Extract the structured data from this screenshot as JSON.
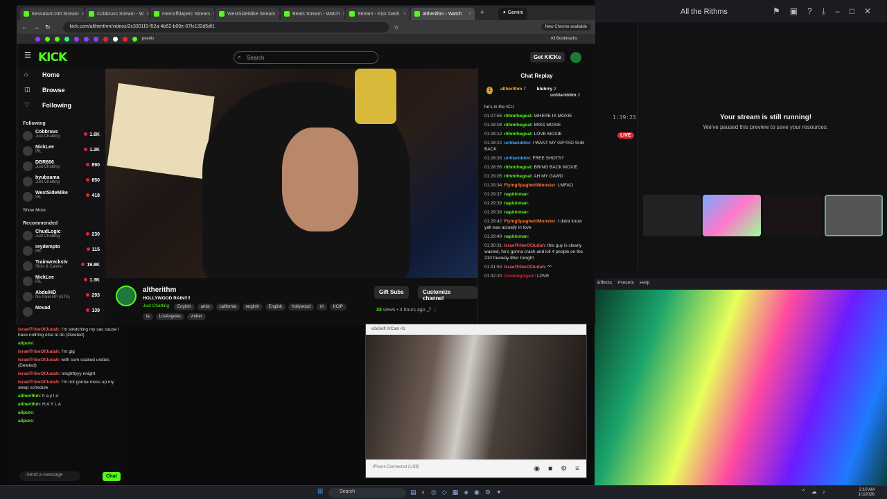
{
  "browser": {
    "tabs": [
      "Kevsaturn100 Stream",
      "Cobbruvs Stream - W",
      "mercoffdaperc Stream",
      "WestSideMike Stream",
      "Beats Stream - Watch",
      "Stream - Kick Dash",
      "altherithm - Watch"
    ],
    "gemini": "Gemini",
    "url": "kick.com/altherithm/videos/2c3301f3-f52a-4b52-b00e-07fc132d5df1",
    "new_chrome": "New Chrome available",
    "all_bookmarks": "All Bookmarks",
    "pexels": "pexels"
  },
  "kick": {
    "logo": "KICK",
    "search_placeholder": "Search",
    "get_kicks": "Get KICKs",
    "nav": [
      {
        "label": "Home",
        "icon": "home-icon"
      },
      {
        "label": "Browse",
        "icon": "browse-icon"
      },
      {
        "label": "Following",
        "icon": "heart-icon"
      }
    ],
    "following_header": "Following",
    "following": [
      {
        "name": "Cobbruvs",
        "category": "Just Chatting",
        "viewers": "1.6K"
      },
      {
        "name": "NickLee",
        "category": "IRL",
        "viewers": "1.2K"
      },
      {
        "name": "DBR666",
        "category": "Just Chatting",
        "viewers": "890"
      },
      {
        "name": "hyubsama",
        "category": "Just Chatting",
        "viewers": "850"
      },
      {
        "name": "WestSideMike",
        "category": "IRL",
        "viewers": "418"
      }
    ],
    "show_more": "Show More",
    "recommended_header": "Recommended",
    "recommended": [
      {
        "name": "ChudLogic",
        "category": "Just Chatting",
        "viewers": "230"
      },
      {
        "name": "reydempto",
        "category": "IRL",
        "viewers": "115"
      },
      {
        "name": "Trainwreckstv",
        "category": "Slots & Casino",
        "viewers": "19.8K"
      },
      {
        "name": "NickLee",
        "category": "IRL",
        "viewers": "1.3K"
      },
      {
        "name": "AbdulHD",
        "category": "No Pixel RP (GTA)",
        "viewers": "293"
      },
      {
        "name": "Novad",
        "category": "",
        "viewers": "139"
      }
    ],
    "channel": {
      "name": "altherithm",
      "title": "HOLLYWOOD RAIN!!!!",
      "category": "Just Chatting",
      "tags": [
        "English",
        "artist",
        "california",
        "english",
        "English",
        "hollywood",
        "irl",
        "KCIP",
        "la",
        "LosAngeles",
        "vtuber"
      ],
      "gift_subs": "Gift Subs",
      "customize": "Customize channel",
      "views": "33",
      "views_label": "views",
      "ago": "4 hours ago"
    },
    "chat": {
      "header": "Chat Replay",
      "top": [
        {
          "rank": "1",
          "name": "altherithm",
          "count": "7"
        },
        {
          "name": "bluhrry",
          "count": "2"
        },
        {
          "name": "unfdariddim",
          "count": "2"
        }
      ],
      "first_line": "he's in the ICU",
      "messages": [
        {
          "time": "01:27:56",
          "user": "rithmthegoat",
          "text": ": WHERE IS MOXIE",
          "color": "#53fc18"
        },
        {
          "time": "01:28:08",
          "user": "rithmthegoat",
          "text": ": MISS MOXIE",
          "color": "#53fc18"
        },
        {
          "time": "01:28:12",
          "user": "rithmthegoat",
          "text": ": LOVE MOXIE",
          "color": "#53fc18"
        },
        {
          "time": "01:28:22",
          "user": "unfdariddim",
          "text": ": I WANT MY GIFTED SUB BACK",
          "color": "#4aa3ff"
        },
        {
          "time": "01:28:33",
          "user": "unfdariddim",
          "text": ": FREE SHOTS?",
          "color": "#4aa3ff"
        },
        {
          "time": "01:28:56",
          "user": "rithmthegoat",
          "text": ": BRING BACK MOXIE",
          "color": "#53fc18"
        },
        {
          "time": "01:29:05",
          "user": "rithmthegoat",
          "text": ": AH MY GAWD",
          "color": "#53fc18"
        },
        {
          "time": "01:29:34",
          "user": "FlyingSpaghettiMonster",
          "text": ": LMFAO",
          "color": "#ff7a2e"
        },
        {
          "time": "01:29:37",
          "user": "napkinman",
          "text": ":",
          "color": "#53fc18"
        },
        {
          "time": "01:29:39",
          "user": "napkinman",
          "text": ":",
          "color": "#53fc18"
        },
        {
          "time": "01:29:39",
          "user": "napkinman",
          "text": ":",
          "color": "#53fc18"
        },
        {
          "time": "01:29:42",
          "user": "FlyingSpaghettiMonster",
          "text": ": I didnt know yall was actually in love",
          "color": "#ff7a2e"
        },
        {
          "time": "01:29:48",
          "user": "napkinman",
          "text": ":",
          "color": "#53fc18"
        },
        {
          "time": "01:30:31",
          "user": "IsraelTribeOfJudah",
          "text": ": this guy is clearly wasted, he's gonna crash and kill 4 people on the 210 freeway l8ter tonight",
          "color": "#e95a5a"
        },
        {
          "time": "01:31:50",
          "user": "IsraelTribeOfJudah",
          "text": ": ^^",
          "color": "#e95a5a"
        },
        {
          "time": "01:32:20",
          "user": "CookingAgain",
          "text": ": LOVE",
          "color": "#e0242e"
        }
      ]
    }
  },
  "live_chat": {
    "messages": [
      {
        "user": "IsraelTribeOfJudah",
        "text": ": I'm stretching my sac cause I have nothing else to do (Deleted)",
        "color": "red"
      },
      {
        "user": "alipure",
        "text": ":",
        "color": "green"
      },
      {
        "user": "IsraelTribeOfJudah",
        "text": ": I'm gtg",
        "color": "red"
      },
      {
        "user": "IsraelTribeOfJudah",
        "text": ": with cum soaked undies (Deleted)",
        "color": "red"
      },
      {
        "user": "IsraelTribeOfJudah",
        "text": ": nnighttyyy nnight",
        "color": "red"
      },
      {
        "user": "IsraelTribeOfJudah",
        "text": ": I'm not gonna mess up my sleep schedule",
        "color": "red"
      },
      {
        "user": "altherithm",
        "text": ": h a y l a",
        "color": "green"
      },
      {
        "user": "altherithm",
        "text": ": H A Y L A",
        "color": "green"
      },
      {
        "user": "alipure",
        "text": ":",
        "color": "green"
      },
      {
        "user": "alipure",
        "text": ":",
        "color": "green"
      }
    ],
    "send_placeholder": "Send a message",
    "chat_button": "Chat"
  },
  "right": {
    "discord_title": "All the Rithms",
    "timestamp": "1:39:23",
    "live": "LIVE",
    "stream_running": "Your stream is still running!",
    "paused": "We've paused this preview to save your resources.",
    "obs_menu": [
      "Effects",
      "Presets",
      "Help"
    ]
  },
  "vcam": {
    "title": "e2eSoft iVCam #1",
    "status": "iPhone Connected (USB)"
  },
  "taskbar": {
    "search": "Search",
    "time": "2:10 AM",
    "date": "1/1/2026"
  }
}
